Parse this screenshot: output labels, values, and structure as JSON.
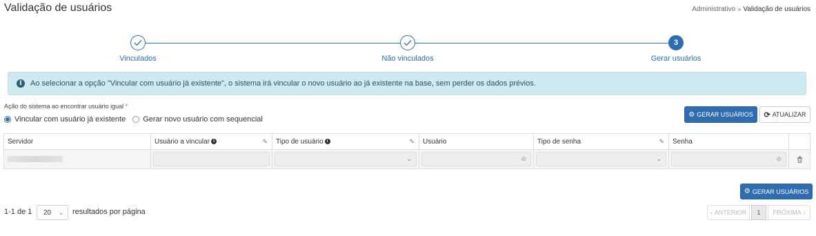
{
  "header": {
    "title": "Validação de usuários",
    "breadcrumb": [
      "Administrativo",
      "Validação de usuários"
    ],
    "breadcrumb_separator": ">"
  },
  "stepper": {
    "steps": [
      {
        "label": "Vinculados",
        "state": "done",
        "marker": "check-icon"
      },
      {
        "label": "Não vinculados",
        "state": "done",
        "marker": "check-icon"
      },
      {
        "label": "Gerar usuários",
        "state": "active",
        "marker": "3"
      }
    ],
    "accent": "#2f6db0"
  },
  "alert": {
    "text": "Ao selecionar a opção \"Vincular com usuário já existente\", o sistema irá vincular o novo usuário ao já existente na base, sem perder os dados prévios.",
    "icon": "info-icon",
    "color": "#cfe9f1"
  },
  "action": {
    "label": "Ação do sistema ao encontrar usuário igual",
    "required_mark": "*",
    "options": [
      {
        "label": "Vincular com usuário já existente",
        "checked": true
      },
      {
        "label": "Gerar novo usuário com sequencial",
        "checked": false
      }
    ]
  },
  "toolbar": {
    "generate_label": "GERAR USUÁRIOS",
    "refresh_label": "ATUALIZAR"
  },
  "table": {
    "columns": [
      {
        "label": "Servidor",
        "info": false,
        "eraser": false
      },
      {
        "label": "Usuário a vincular",
        "info": true,
        "eraser": true
      },
      {
        "label": "Tipo de usuário",
        "info": true,
        "eraser": true
      },
      {
        "label": "Usuário",
        "info": false,
        "eraser": false
      },
      {
        "label": "Tipo de senha",
        "info": false,
        "eraser": true
      },
      {
        "label": "Senha",
        "info": false,
        "eraser": false
      }
    ]
  },
  "footer": {
    "generate_label": "GERAR USUÁRIOS",
    "range_text": "1-1 de 1",
    "page_size": "20",
    "results_label": "resultados por página",
    "prev_label": "ANTERIOR",
    "current_page": "1",
    "next_label": "PRÓXIMA"
  }
}
